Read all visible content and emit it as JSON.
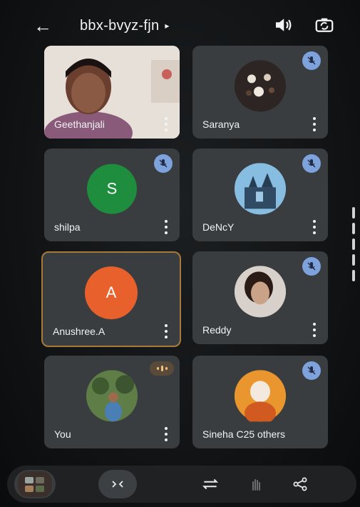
{
  "meeting": {
    "code": "bbx-bvyz-fjn"
  },
  "header": {
    "back_icon": "arrow-back-icon",
    "audio_icon": "speaker-icon",
    "flip_icon": "flip-camera-icon"
  },
  "participants": [
    {
      "name": "Geethanjali",
      "type": "video",
      "muted": false
    },
    {
      "name": "Saranya",
      "type": "photo",
      "muted": true
    },
    {
      "name": "shilpa",
      "type": "initial",
      "initial": "S",
      "color": "#1e8e3e",
      "muted": true
    },
    {
      "name": "DeNcY",
      "type": "photo",
      "muted": true
    },
    {
      "name": "Anushree.A",
      "type": "initial",
      "initial": "A",
      "color": "#e8602c",
      "muted": false,
      "active": true
    },
    {
      "name": "Reddy",
      "type": "photo",
      "muted": true
    },
    {
      "name": "You",
      "type": "photo",
      "muted": false,
      "speaking": true
    },
    {
      "name": "Sineha C25 others",
      "type": "photo",
      "muted": true
    }
  ],
  "controls": {
    "items": [
      "grid-thumbnail",
      "captions-icon",
      "flip-camera-icon",
      "hand-icon",
      "share-icon"
    ]
  },
  "colors": {
    "background": "#0d0f10",
    "tile": "#3a3d40",
    "mute_badge": "#8ab4f8",
    "active_border": "#a77a3a"
  }
}
